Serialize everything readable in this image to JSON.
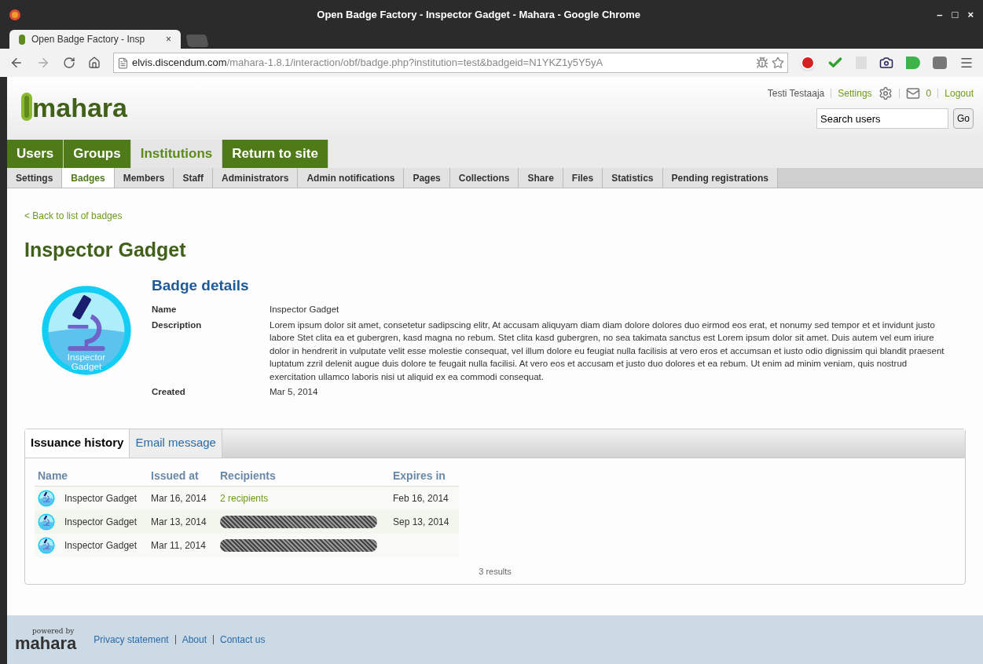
{
  "window": {
    "title": "Open Badge Factory - Inspector Gadget - Mahara - Google Chrome",
    "controls": [
      "–",
      "□",
      "×"
    ]
  },
  "browser_tab": {
    "title": "Open Badge Factory - Insp",
    "close": "×"
  },
  "address": {
    "host": "elvis.discendum.com",
    "path": "/mahara-1.8.1/interaction/obf/badge.php?institution=test&badgeid=N1YKZ1y5Y5yA"
  },
  "header": {
    "logo": "mahara",
    "user": "Testi Testaaja",
    "settings": "Settings",
    "messages": "0",
    "logout": "Logout",
    "search": {
      "value": "Search users"
    },
    "go": "Go"
  },
  "main_nav": [
    {
      "label": "Users",
      "selected": false
    },
    {
      "label": "Groups",
      "selected": false
    },
    {
      "label": "Institutions",
      "selected": true
    },
    {
      "label": "Return to site",
      "selected": false
    }
  ],
  "sub_nav": [
    {
      "label": "Settings",
      "selected": false
    },
    {
      "label": "Badges",
      "selected": true
    },
    {
      "label": "Members",
      "selected": false
    },
    {
      "label": "Staff",
      "selected": false
    },
    {
      "label": "Administrators",
      "selected": false
    },
    {
      "label": "Admin notifications",
      "selected": false
    },
    {
      "label": "Pages",
      "selected": false
    },
    {
      "label": "Collections",
      "selected": false
    },
    {
      "label": "Share",
      "selected": false
    },
    {
      "label": "Files",
      "selected": false
    },
    {
      "label": "Statistics",
      "selected": false
    },
    {
      "label": "Pending registrations",
      "selected": false
    }
  ],
  "back_link": "< Back to list of badges",
  "page_title": "Inspector Gadget",
  "badge_image_text": [
    "Inspector",
    "Gadget"
  ],
  "details": {
    "heading": "Badge details",
    "fields": [
      {
        "label": "Name",
        "value": "Inspector Gadget"
      },
      {
        "label": "Description",
        "value": "Lorem ipsum dolor sit amet, consetetur sadipscing elitr, At accusam aliquyam diam diam dolore dolores duo eirmod eos erat, et nonumy sed tempor et et invidunt justo labore Stet clita ea et gubergren, kasd magna no rebum. Stet clita kasd gubergren, no sea takimata sanctus est Lorem ipsum dolor sit amet. Duis autem vel eum iriure dolor in hendrerit in vulputate velit esse molestie consequat, vel illum dolore eu feugiat nulla facilisis at vero eros et accumsan et iusto odio dignissim qui blandit praesent luptatum zzril delenit augue duis dolore te feugait nulla facilisi. At vero eos et accusam et justo duo dolores et ea rebum. Ut enim ad minim veniam, quis nostrud exercitation ullamco laboris nisi ut aliquid ex ea commodi consequat."
      },
      {
        "label": "Created",
        "value": "Mar 5, 2014"
      }
    ]
  },
  "tabs": [
    {
      "label": "Issuance history",
      "selected": true
    },
    {
      "label": "Email message",
      "selected": false
    }
  ],
  "table": {
    "columns": [
      "Name",
      "Issued at",
      "Recipients",
      "Expires in"
    ],
    "rows": [
      {
        "name": "Inspector Gadget",
        "issued": "Mar 16, 2014",
        "recipients": {
          "kind": "link",
          "text": "2 recipients"
        },
        "expires": "Feb 16, 2014"
      },
      {
        "name": "Inspector Gadget",
        "issued": "Mar 13, 2014",
        "recipients": {
          "kind": "redacted"
        },
        "expires": "Sep 13, 2014"
      },
      {
        "name": "Inspector Gadget",
        "issued": "Mar 11, 2014",
        "recipients": {
          "kind": "redacted"
        }
      }
    ],
    "results": "3 results"
  },
  "footer": {
    "logo_top": "powered by",
    "logo": "mahara",
    "links": [
      "Privacy statement",
      "About",
      "Contact us"
    ]
  }
}
